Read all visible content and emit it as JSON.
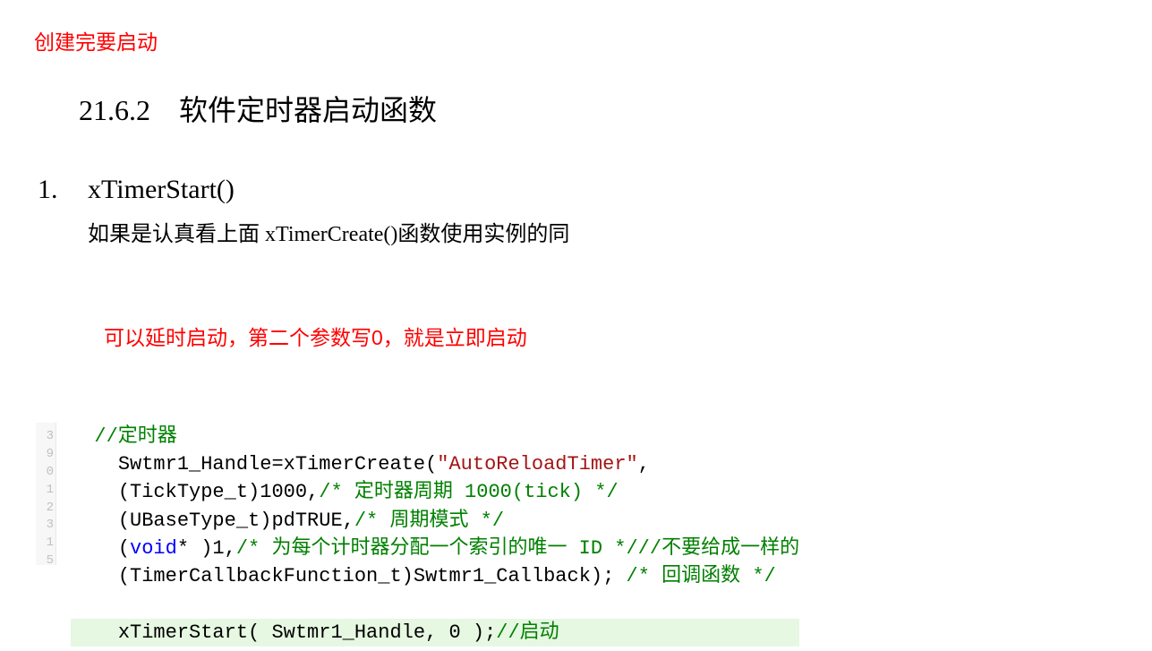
{
  "annotation_top": "创建完要启动",
  "section": {
    "number": "21.6.2",
    "title": "软件定时器启动函数"
  },
  "item": {
    "number": "1.",
    "title": "xTimerStart()",
    "desc": "如果是认真看上面 xTimerCreate()函数使用实例的同"
  },
  "annotation_mid": "可以延时启动，第二个参数写0，就是立即启动",
  "code": {
    "gutter": [
      "3",
      "9",
      "0",
      "1",
      "2",
      "3",
      "1",
      "5"
    ],
    "l1": {
      "indent": "  ",
      "c1": "//定时器"
    },
    "l2": {
      "indent": "    ",
      "t1": "Swtmr1_Handle=xTimerCreate(",
      "s1": "\"AutoReloadTimer\"",
      "t2": ","
    },
    "l3": {
      "indent": "    ",
      "t1": "(TickType_t)1000,",
      "c1": "/* 定时器周期 1000(tick) */"
    },
    "l4": {
      "indent": "    ",
      "t1": "(UBaseType_t)pdTRUE,",
      "c1": "/* 周期模式 */"
    },
    "l5": {
      "indent": "    ",
      "t1": "(",
      "k1": "void",
      "t2": "* )1,",
      "c1": "/* 为每个计时器分配一个索引的唯一 ID */",
      "c2": "//不要给成一样的"
    },
    "l6": {
      "indent": "    ",
      "t1": "(TimerCallbackFunction_t)Swtmr1_Callback); ",
      "c1": "/* 回调函数 */"
    },
    "gap": " ",
    "l8": {
      "indent": "    ",
      "t1": "xTimerStart( Swtmr1_Handle, 0 );",
      "c1": "//启动"
    }
  }
}
